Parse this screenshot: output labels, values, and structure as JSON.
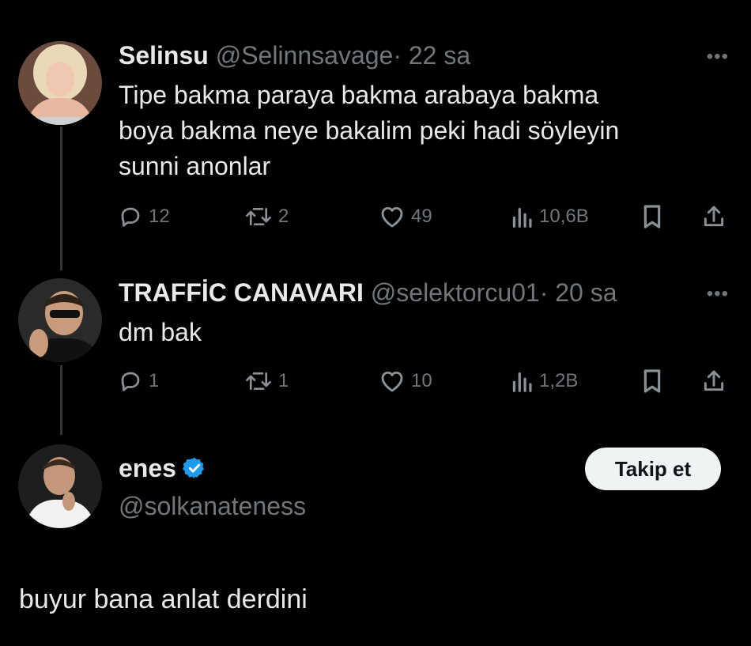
{
  "tweets": [
    {
      "name": "Selinsu",
      "handle": "@Selinnsavage",
      "separator": "·",
      "time": "22 sa",
      "more_label": "•••",
      "text_lines": [
        "Tipe bakma paraya bakma arabaya bakma",
        "boya bakma neye bakalim peki hadi söyleyin",
        "sunni anonlar"
      ],
      "replies": "12",
      "retweets": "2",
      "likes": "49",
      "views": "10,6B"
    },
    {
      "name": "TRAFFİC CANAVARI",
      "handle": "@selektorcu01",
      "separator": "·",
      "time": "20 sa",
      "more_label": "•••",
      "text_lines": [
        "dm bak"
      ],
      "replies": "1",
      "retweets": "1",
      "likes": "10",
      "views": "1,2B"
    }
  ],
  "profile": {
    "name": "enes",
    "handle": "@solkanateness",
    "follow_label": "Takip et",
    "verified_color": "#1d9bf0",
    "bio": "buyur bana anlat derdini"
  },
  "icons": {
    "reply": "reply-icon",
    "retweet": "retweet-icon",
    "like": "heart-icon",
    "views": "views-icon",
    "bookmark": "bookmark-icon",
    "share": "share-icon",
    "verified": "verified-badge-icon"
  },
  "colors": {
    "background": "#000000",
    "text": "#e7e9ea",
    "secondary": "#71767b",
    "thread_line": "#333639"
  }
}
